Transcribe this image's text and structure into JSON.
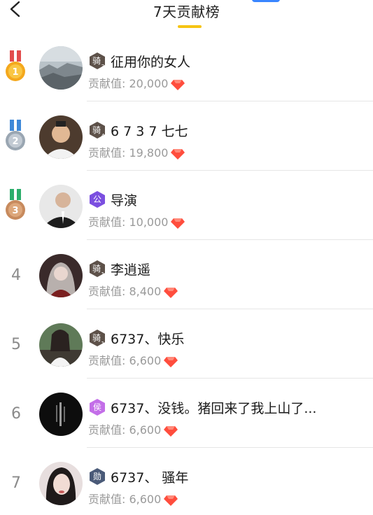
{
  "header": {
    "title": "7天贡献榜"
  },
  "colors": {
    "accent": "#f6c413",
    "gem": "#ff4d3d"
  },
  "ranking": [
    {
      "rank": "1",
      "name": "征用你的女人",
      "badge_char": "骑",
      "badge_level": "3",
      "contribution": "贡献值: 20,000"
    },
    {
      "rank": "2",
      "name": "6 7 3 7 七七",
      "badge_char": "骑",
      "badge_level": "4",
      "contribution": "贡献值: 19,800"
    },
    {
      "rank": "3",
      "name": "导演",
      "badge_char": "公",
      "badge_level": "",
      "contribution": "贡献值: 10,000"
    },
    {
      "rank": "4",
      "name": "李逍遥",
      "badge_char": "骑",
      "badge_level": "1",
      "contribution": "贡献值: 8,400"
    },
    {
      "rank": "5",
      "name": "6737、快乐",
      "badge_char": "骑",
      "badge_level": "1",
      "contribution": "贡献值: 6,600"
    },
    {
      "rank": "6",
      "name": "6737、没钱。猪回来了我上山了...",
      "badge_char": "侯",
      "badge_level": "",
      "contribution": "贡献值: 6,600"
    },
    {
      "rank": "7",
      "name": "6737、  骚年",
      "badge_char": "勋",
      "badge_level": "",
      "contribution": "贡献值: 6,600"
    }
  ]
}
